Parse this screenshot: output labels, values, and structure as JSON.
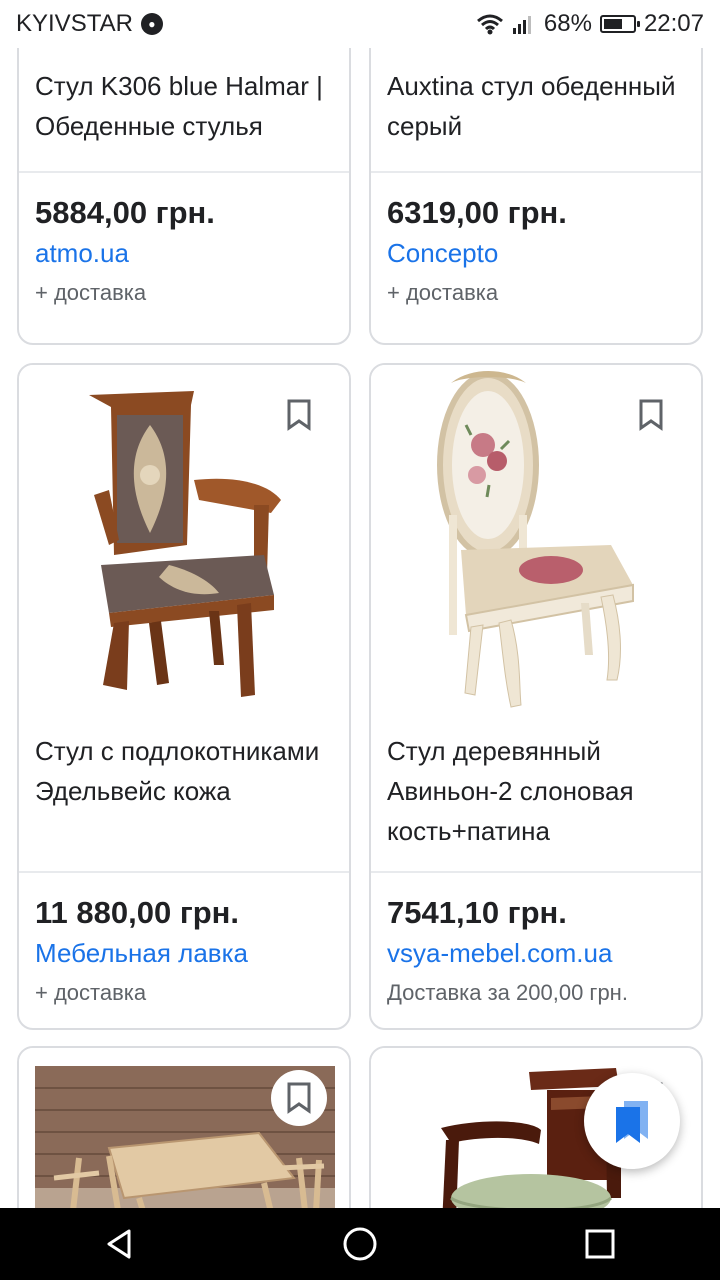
{
  "status_bar": {
    "carrier": "KYIVSTAR",
    "battery_percent": "68%",
    "battery_level": 0.68,
    "time": "22:07",
    "icons": [
      "recording-icon",
      "wifi-icon",
      "signal-icon",
      "battery-icon"
    ]
  },
  "products": [
    {
      "title": "Стул K306 blue Halmar | Обеденные стулья",
      "price": "5884,00 грн.",
      "store": "atmo.ua",
      "shipping": "+ доставка"
    },
    {
      "title": "Auxtina стул обеденный серый",
      "price": "6319,00 грн.",
      "store": "Concepto",
      "shipping": "+ доставка"
    },
    {
      "title": "Стул с подлокотниками Эдельвейс кожа",
      "price": "11 880,00 грн.",
      "store": "Мебельная лавка",
      "shipping": "+ доставка",
      "image": "armchair-brown-damask"
    },
    {
      "title": "Стул деревянный Авиньон-2 слоновая кость+патина",
      "price": "7541,10 грн.",
      "store": "vsya-mebel.com.ua",
      "shipping": "Доставка за 200,00 грн.",
      "image": "chair-ivory-floral"
    },
    {
      "image": "folding-table-chairs-set"
    },
    {
      "image": "armchair-dark-wood-green"
    }
  ],
  "colors": {
    "link": "#1a73e8",
    "text": "#202124",
    "muted": "#5f6368",
    "border": "#dadce0",
    "fab_icon": "#1a73e8"
  },
  "fab": {
    "icon": "saved-collections-icon"
  },
  "nav_bar": {
    "icons": [
      "back-icon",
      "home-icon",
      "recents-icon"
    ]
  }
}
